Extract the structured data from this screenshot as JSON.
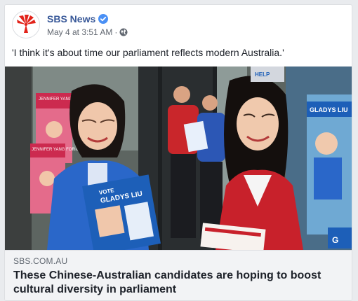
{
  "post": {
    "page_name": "SBS News",
    "timestamp": "May 4 at 3:51 AM",
    "separator": "·",
    "privacy_icon": "globe-icon",
    "verified_icon": "verified-badge-icon",
    "text": "'I think it's about time our parliament reflects modern Australia.'"
  },
  "media": {
    "poster_text": {
      "left_top": "JENNIFER YANG FOR CHISHOLM",
      "left_bottom": "JENNIFER YANG FOR CHISHOLM",
      "flyer_name": "GLADYS LIU",
      "flyer_vote": "VOTE",
      "right_sign": "GLADYS LIU",
      "window_sign": "HELP"
    }
  },
  "link_preview": {
    "domain": "SBS.COM.AU",
    "headline": "These Chinese-Australian candidates are hoping to boost cultural diversity in parliament"
  },
  "colors": {
    "link_blue": "#385898",
    "verified_blue": "#4a90f5",
    "sbs_red": "#e2231a"
  }
}
